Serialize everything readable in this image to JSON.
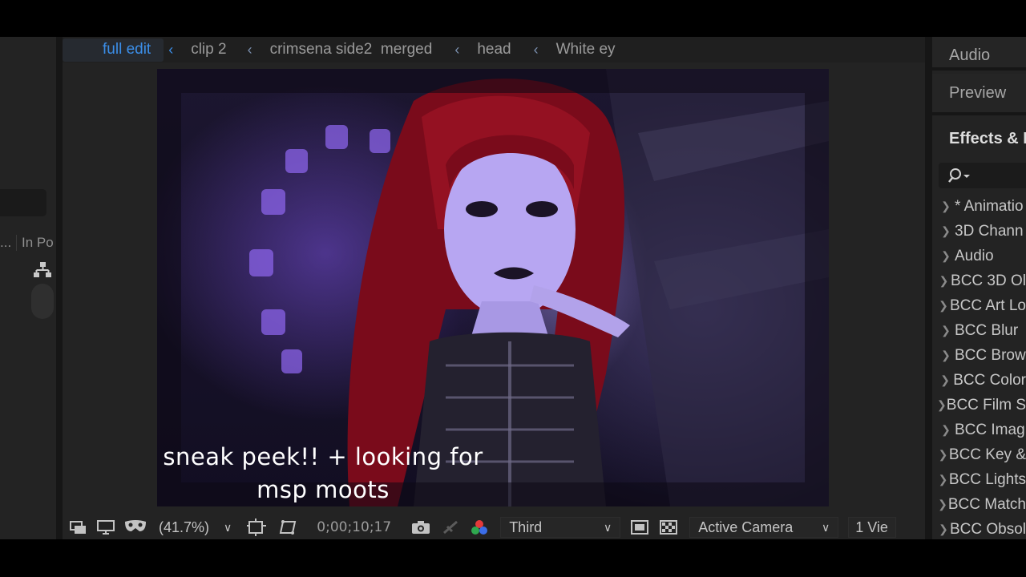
{
  "breadcrumbs": [
    {
      "label": "full edit",
      "active": true
    },
    {
      "label": "clip 2"
    },
    {
      "label": "crimsena side2  merged"
    },
    {
      "label": "head"
    },
    {
      "label": "White ey"
    }
  ],
  "separator": "‹",
  "left_panel": {
    "column_header": "In Po",
    "column_dots": "..."
  },
  "viewer": {
    "caption_line1": "sneak peek!! + looking for",
    "caption_line2": "msp moots"
  },
  "toolbar": {
    "zoom": "(41.7%)",
    "timecode": "0;00;10;17",
    "resolution": "Third",
    "camera": "Active Camera",
    "views": "1 Vie"
  },
  "right_panel": {
    "tabs": [
      "Audio",
      "Preview",
      "Effects & P"
    ],
    "effects": [
      "* Animatio",
      "3D Chann",
      "Audio",
      "BCC 3D Ol",
      "BCC Art Lo",
      "BCC Blur",
      "BCC Brow",
      "BCC Color",
      "BCC Film S",
      "BCC Imag",
      "BCC Key &",
      "BCC Lights",
      "BCC Match",
      "BCC Obsol"
    ]
  },
  "colors": {
    "accent": "#3b8ee8",
    "panel": "#232323",
    "background": "#1d1d1d"
  }
}
